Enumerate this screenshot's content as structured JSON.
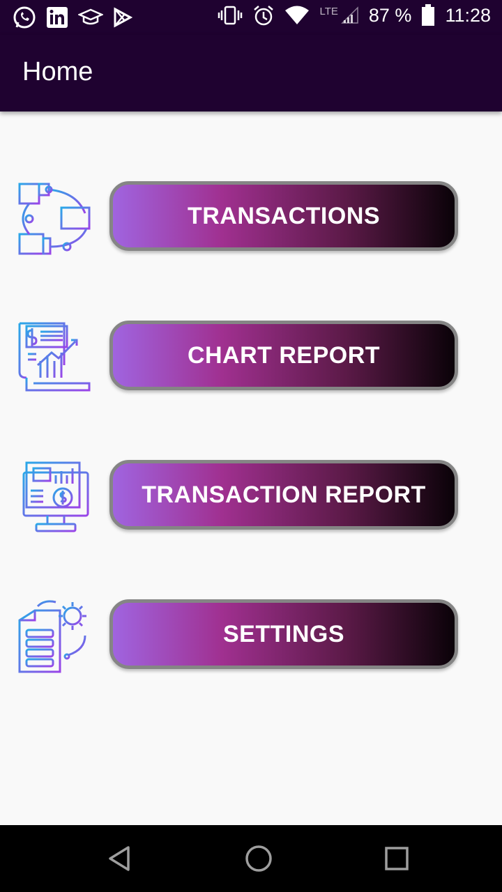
{
  "status_bar": {
    "icons_left": [
      "whatsapp-icon",
      "linkedin-icon",
      "graduation-cap-icon",
      "play-store-icon"
    ],
    "network_label": "LTE",
    "battery_text": "87 %",
    "time": "11:28"
  },
  "app_bar": {
    "title": "Home"
  },
  "menu": {
    "items": [
      {
        "label": "TRANSACTIONS",
        "icon": "transactions-flow-icon"
      },
      {
        "label": "CHART REPORT",
        "icon": "chart-report-icon"
      },
      {
        "label": "TRANSACTION REPORT",
        "icon": "monitor-report-icon"
      },
      {
        "label": "SETTINGS",
        "icon": "settings-document-icon"
      }
    ]
  },
  "colors": {
    "app_bar": "#1f0230",
    "background": "#f9f9f9",
    "button_gradient": [
      "#a064e0",
      "#a03090",
      "#5c1a48",
      "#0a0208"
    ],
    "button_border": "#858585",
    "icon_gradient": [
      "#2aa8e8",
      "#9a44e8"
    ]
  },
  "nav_bar": {
    "buttons": [
      "back-icon",
      "home-icon",
      "recents-icon"
    ]
  }
}
